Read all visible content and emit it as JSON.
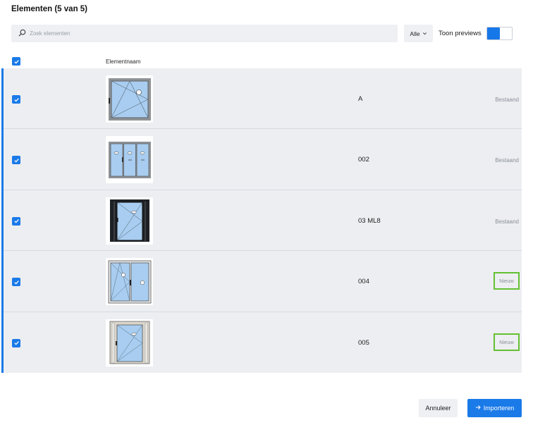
{
  "title": "Elementen (5 van 5)",
  "search": {
    "placeholder": "Zoek elementen",
    "value": ""
  },
  "filter": {
    "label": "Alle"
  },
  "previews_toggle": {
    "label": "Toon previews",
    "on": true
  },
  "table": {
    "column_header": "Elementnaam",
    "rows": [
      {
        "name": "A",
        "status": "Bestaand",
        "checked": true,
        "preview": "window-tilt-turn"
      },
      {
        "name": "002",
        "status": "Bestaand",
        "checked": true,
        "preview": "window-triple-sliding"
      },
      {
        "name": "03 ML8",
        "status": "Bestaand",
        "checked": true,
        "preview": "door-dark-frame"
      },
      {
        "name": "004",
        "status": "Nieuw",
        "checked": true,
        "preview": "window-double"
      },
      {
        "name": "005",
        "status": "Nieuw",
        "checked": true,
        "preview": "door-light-frame"
      }
    ]
  },
  "buttons": {
    "cancel": "Annuleer",
    "import": "Importeren"
  },
  "colors": {
    "accent": "#1a7ae8",
    "highlight": "#64c032",
    "row_bg": "#eceef1"
  }
}
